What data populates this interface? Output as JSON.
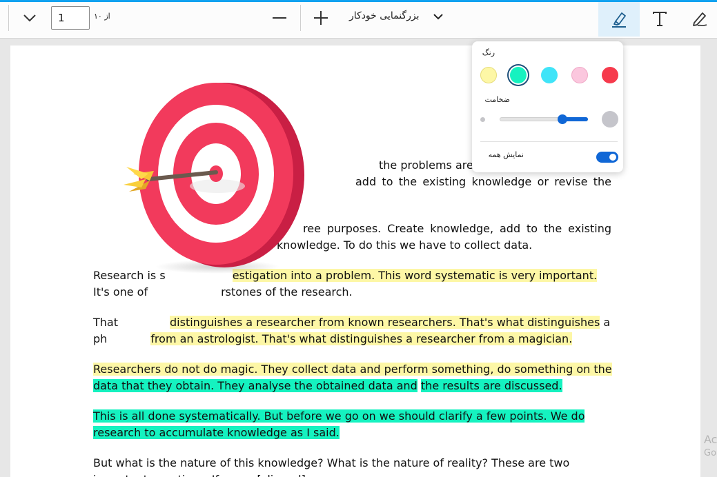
{
  "toolbar": {
    "page_number": "1",
    "page_of": "از ۱۰",
    "zoom_label": "بزرگنمایی خودکار"
  },
  "popup": {
    "color_label": "رنگ",
    "thickness_label": "ضخامت",
    "show_all_label": "نمایش همه",
    "thickness_value": 0.75,
    "show_all": true,
    "colors": [
      "#fdf7a6",
      "#15f2c0",
      "#40e4f8",
      "#fbc7de",
      "#f63a4c"
    ],
    "selected_color": "#15f2c0"
  },
  "document": {
    "p1": {
      "l1": "the problems are",
      "l2": "add to the existing knowledge or revise the"
    },
    "p2": {
      "l1": "ree purposes. Create knowledge, add to the existing",
      "l2": "knowledge. To do this we have to collect data."
    },
    "p3": {
      "l1a": "Research is s",
      "l1b": "estigation into a problem. This word systematic is very important.",
      "l2a": "It's one of",
      "l2b": "rstones of the research."
    },
    "p4": {
      "l1a": "That",
      "l1b": "distinguishes a researcher from known researchers. That's what distinguishes",
      "l1c": " a",
      "l2a": "ph",
      "l2b": "from an astrologist. That's what distinguishes a researcher from a magician."
    },
    "p5": {
      "l1": "Researchers do not do magic. They collect data and perform something, do something on the",
      "l2a": "data that they obtain. They analyse the obtained data and",
      "l2b": "the results are discussed."
    },
    "p6": {
      "l1": "This is all done systematically. But before we go on we should clarify a few points. We do",
      "l2": "research to accumulate knowledge as I said."
    },
    "p7": {
      "l1": "But what is the nature of this knowledge? What is the nature of reality? These are two",
      "l2": "important questions. If one... [clipped]"
    }
  },
  "watermark": {
    "line1": "Ac",
    "line2": "Go"
  }
}
